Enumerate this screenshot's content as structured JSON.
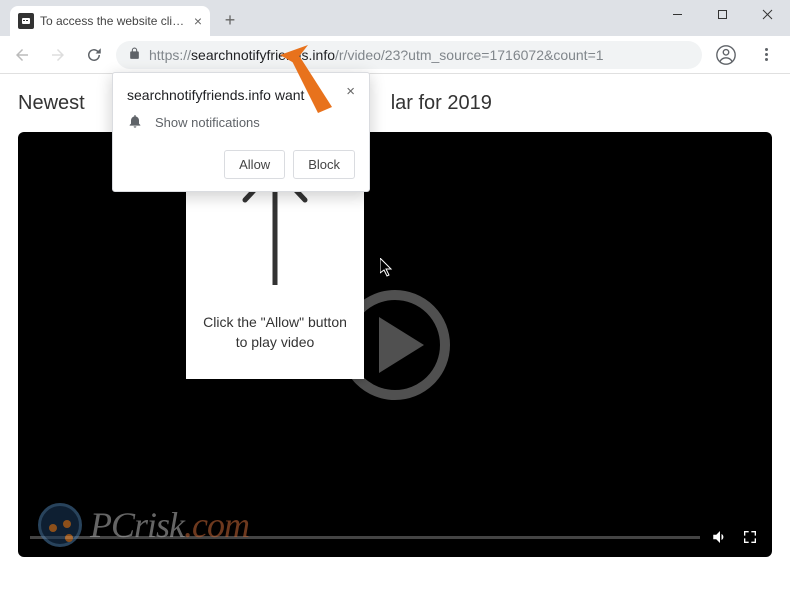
{
  "browser": {
    "tab_title": "To access the website click the \"A",
    "url_scheme": "https://",
    "url_domain": "searchnotifyfriends.info",
    "url_path": "/r/video/23?utm_source=1716072&count=1"
  },
  "notification": {
    "origin": "searchnotifyfriends.info want",
    "prompt": "Show notifications",
    "allow": "Allow",
    "block": "Block"
  },
  "page": {
    "header_left": "Newest",
    "header_right": "lar for 2019"
  },
  "overlay": {
    "line1": "Click the \"Allow\" button",
    "line2": "to play video"
  },
  "watermark": {
    "text_pc": "PC",
    "text_risk": "risk",
    "text_dotcom": ".com"
  },
  "icons": {
    "bell": "bell-icon",
    "lock": "lock-icon",
    "play": "play-icon",
    "volume": "volume-icon",
    "fullscreen": "fullscreen-icon"
  }
}
